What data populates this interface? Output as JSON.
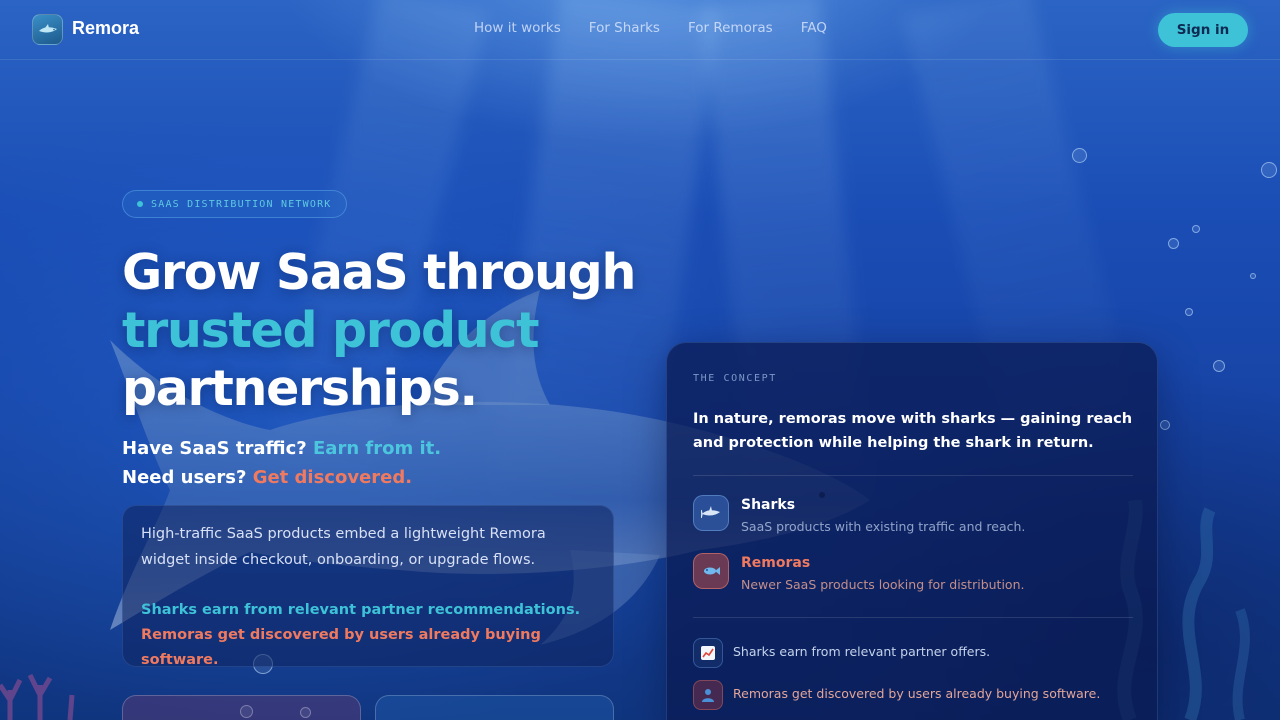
{
  "header": {
    "brand": "Remora",
    "nav": [
      "How it works",
      "For Sharks",
      "For Remoras",
      "FAQ"
    ],
    "signin": "Sign in"
  },
  "hero": {
    "pill": "SAAS DISTRIBUTION NETWORK",
    "title_line1": "Grow SaaS through",
    "title_line2": "trusted product",
    "title_line3": "partnerships.",
    "sub1_prefix": "Have SaaS traffic?",
    "sub1_highlight": "Earn from it.",
    "sub2_prefix": "Need users?",
    "sub2_highlight": "Get discovered.",
    "info_text": "High-traffic SaaS products embed a lightweight Remora widget inside checkout, onboarding, or upgrade flows.",
    "info_sharks": "Sharks earn from relevant partner recommendations.",
    "info_remoras": "Remoras get discovered by users already buying software."
  },
  "concept": {
    "eyebrow": "THE CONCEPT",
    "quote": "In nature, remoras move with sharks — gaining reach and protection while helping the shark in return.",
    "sharks_name": "Sharks",
    "sharks_desc": "SaaS products with existing traffic and reach.",
    "remoras_name": "Remoras",
    "remoras_desc": "Newer SaaS products looking for distribution.",
    "benefit_sharks": "Sharks earn from relevant partner offers.",
    "benefit_remoras": "Remoras get discovered by users already buying software."
  },
  "colors": {
    "accent_teal": "#3ec2d7",
    "accent_coral": "#f07a5f",
    "background": "#1744a6"
  },
  "icons": [
    "logo-icon",
    "shark-icon",
    "remora-fish-icon",
    "chart-up-icon",
    "user-icon"
  ]
}
